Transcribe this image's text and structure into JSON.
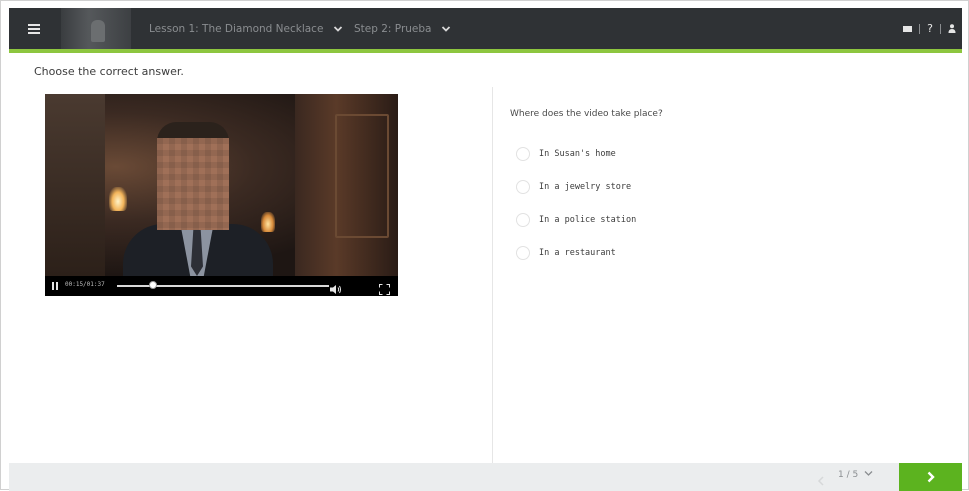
{
  "header": {
    "lesson_label": "Lesson 1: The Diamond Necklace",
    "step_label": "Step 2: Prueba",
    "help_label": "?"
  },
  "colors": {
    "topbar": "#2f3235",
    "accent_line": "#8dc63f",
    "next_button": "#5cb31f",
    "bottombar": "#ebedee"
  },
  "main": {
    "instruction": "Choose the correct answer.",
    "video": {
      "time": "00:15/01:37",
      "progress": 0.17
    },
    "question": "Where does the video take place?",
    "options": [
      "In Susan's home",
      "In a jewelry store",
      "In a police station",
      "In a restaurant"
    ]
  },
  "footer": {
    "pager": "1 / 5"
  }
}
